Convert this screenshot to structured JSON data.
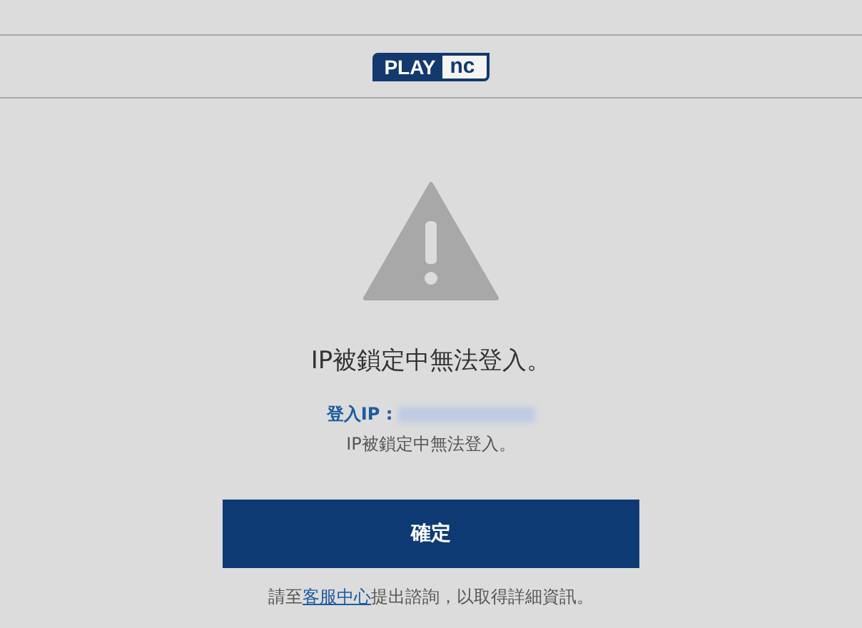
{
  "logo": {
    "left": "PLAY",
    "right": "nc"
  },
  "message": {
    "title": "IP被鎖定中無法登入。",
    "ip_label": "登入IP :",
    "detail": "IP被鎖定中無法登入。"
  },
  "confirm_button": "確定",
  "footer": {
    "before": "請至",
    "link": "客服中心",
    "after": "提出諮詢，以取得詳細資訊。"
  }
}
